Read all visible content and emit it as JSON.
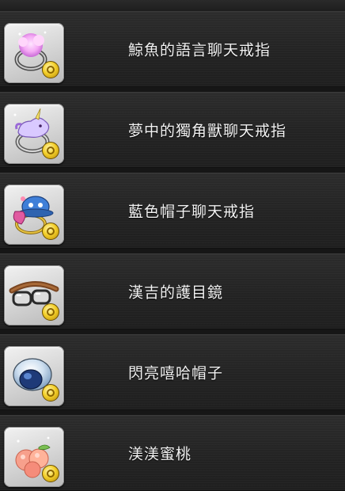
{
  "items": [
    {
      "name": "鯨魚的語言聊天戒指",
      "icon": "whale-chat-ring-icon"
    },
    {
      "name": "夢中的獨角獸聊天戒指",
      "icon": "unicorn-chat-ring-icon"
    },
    {
      "name": "藍色帽子聊天戒指",
      "icon": "blue-hat-chat-ring-icon"
    },
    {
      "name": "漢吉的護目鏡",
      "icon": "goggles-icon"
    },
    {
      "name": "閃亮嘻哈帽子",
      "icon": "hiphop-cap-icon"
    },
    {
      "name": "渼渼蜜桃",
      "icon": "peach-icon"
    }
  ],
  "colors": {
    "row_background": "#262626",
    "label_text": "#f2f2f2",
    "coin": "#f3cf2a"
  }
}
